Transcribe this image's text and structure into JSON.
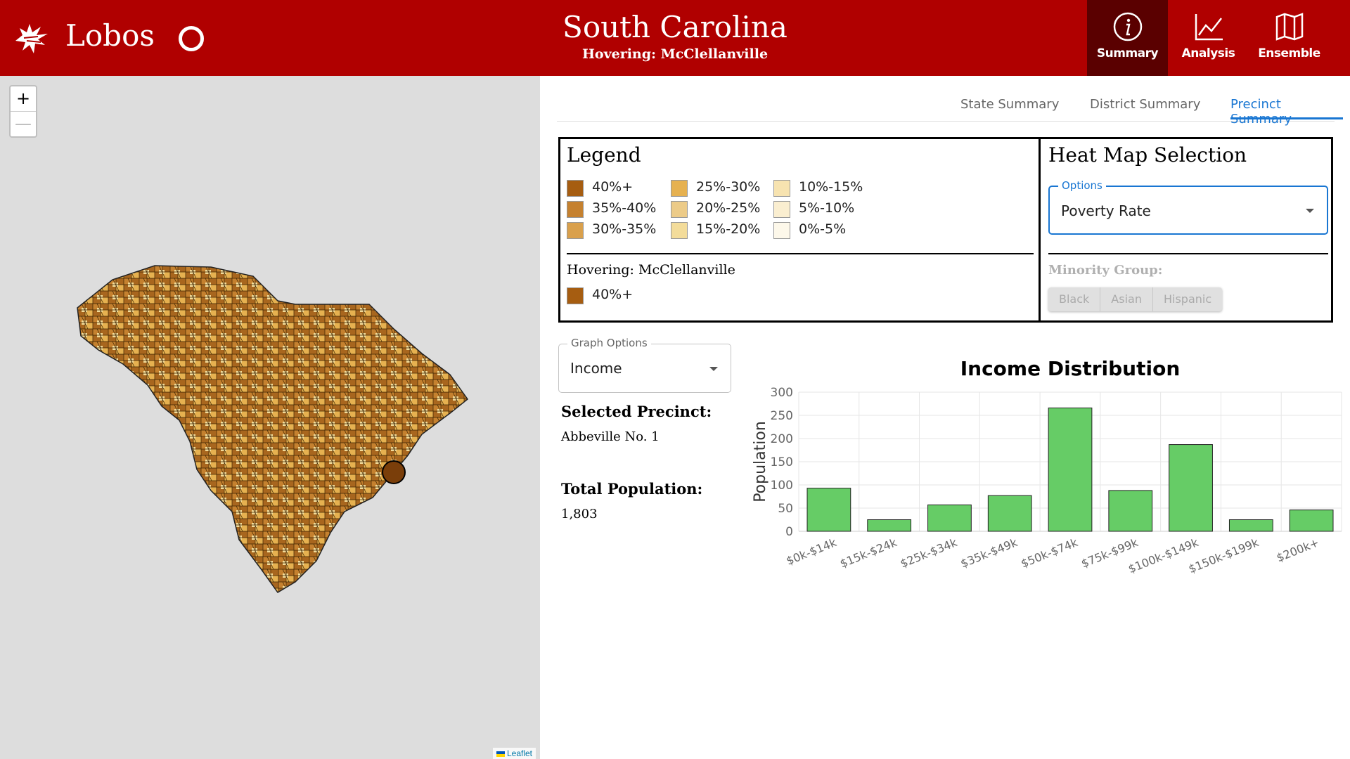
{
  "header": {
    "brand": "Lobos",
    "state_title": "South Carolina",
    "hover_subtitle": "Hovering: McClellanville",
    "nav": [
      {
        "label": "Summary",
        "icon": "info-icon",
        "active": true
      },
      {
        "label": "Analysis",
        "icon": "line-chart-icon",
        "active": false
      },
      {
        "label": "Ensemble",
        "icon": "map-icon",
        "active": false
      }
    ]
  },
  "map": {
    "zoom_in": "+",
    "zoom_out": "—",
    "attribution": "Leaflet"
  },
  "tabs": [
    "State Summary",
    "District Summary",
    "Precinct Summary"
  ],
  "active_tab": "Precinct Summary",
  "legend": {
    "title": "Legend",
    "items": [
      {
        "label": "40%+",
        "color": "#a65d11"
      },
      {
        "label": "35%-40%",
        "color": "#c5812f"
      },
      {
        "label": "30%-35%",
        "color": "#d9a04c"
      },
      {
        "label": "25%-30%",
        "color": "#e6b150"
      },
      {
        "label": "20%-25%",
        "color": "#eccb88"
      },
      {
        "label": "15%-20%",
        "color": "#f3dc9a"
      },
      {
        "label": "10%-15%",
        "color": "#f7e3b0"
      },
      {
        "label": "5%-10%",
        "color": "#faeed0"
      },
      {
        "label": "0%-5%",
        "color": "#fdf8ea"
      }
    ],
    "hovering_label": "Hovering: McClellanville",
    "hovering_value": "40%+",
    "hovering_color": "#a65d11"
  },
  "heatmap": {
    "title": "Heat Map Selection",
    "options_label": "Options",
    "selected": "Poverty Rate",
    "minority_label": "Minority Group:",
    "groups": [
      "Black",
      "Asian",
      "Hispanic"
    ]
  },
  "graph_options": {
    "label": "Graph Options",
    "selected": "Income"
  },
  "precinct": {
    "selected_label": "Selected Precinct:",
    "selected_value": "Abbeville No. 1",
    "population_label": "Total Population:",
    "population_value": "1,803"
  },
  "chart_data": {
    "type": "bar",
    "title": "Income Distribution",
    "xlabel": "",
    "ylabel": "Population",
    "categories": [
      "$0k-$14k",
      "$15k-$24k",
      "$25k-$34k",
      "$35k-$49k",
      "$50k-$74k",
      "$75k-$99k",
      "$100k-$149k",
      "$150k-$199k",
      "$200k+"
    ],
    "values": [
      93,
      25,
      57,
      77,
      266,
      88,
      187,
      25,
      46
    ],
    "ylim": [
      0,
      300
    ],
    "yticks": [
      0,
      50,
      100,
      150,
      200,
      250,
      300
    ],
    "grid": true,
    "bar_color": "#66cc66"
  }
}
